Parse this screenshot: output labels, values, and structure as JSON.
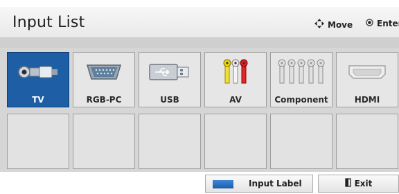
{
  "header": {
    "title": "Input List",
    "hints": [
      {
        "icon": "dpad-icon",
        "label": "Move"
      },
      {
        "icon": "ok-button-icon",
        "label": "Enter"
      }
    ]
  },
  "inputs": [
    {
      "label": "TV",
      "icon": "antenna-plug-icon",
      "selected": true
    },
    {
      "label": "RGB-PC",
      "icon": "vga-port-icon",
      "selected": false
    },
    {
      "label": "USB",
      "icon": "usb-plug-icon",
      "selected": false
    },
    {
      "label": "AV",
      "icon": "rca-plugs-icon",
      "selected": false
    },
    {
      "label": "Component",
      "icon": "component-plugs-icon",
      "selected": false
    },
    {
      "label": "HDMI",
      "icon": "hdmi-port-icon",
      "selected": false
    }
  ],
  "footer": {
    "input_label_button": "Input Label",
    "exit_button": "Exit"
  },
  "colors": {
    "selected_tile": "#1d5ea5",
    "tile": "#e6e6e6",
    "panel": "#d6d6d6",
    "blue_key": "#2a74c8"
  }
}
